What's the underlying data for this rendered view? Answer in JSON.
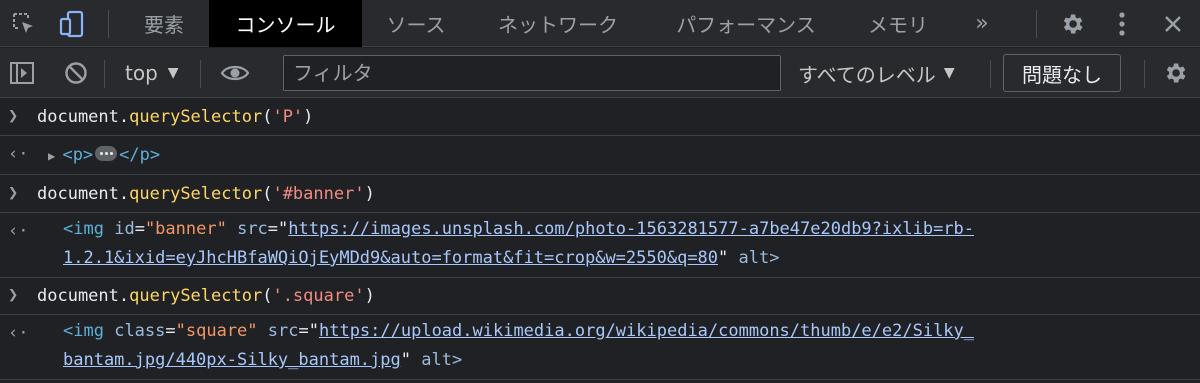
{
  "tabs": {
    "elements": "要素",
    "console": "コンソール",
    "sources": "ソース",
    "network": "ネットワーク",
    "performance": "パフォーマンス",
    "memory": "メモリ",
    "more": "»"
  },
  "toolbar": {
    "context": "top",
    "filter_placeholder": "フィルタ",
    "levels": "すべてのレベル",
    "issues_button": "問題なし"
  },
  "console": {
    "entries": [
      {
        "input_obj": "document",
        "input_method": "querySelector",
        "input_arg": "'P'",
        "output_open": "<p>",
        "output_close": "</p>"
      },
      {
        "input_obj": "document",
        "input_method": "querySelector",
        "input_arg": "'#banner'",
        "tag_open": "<img",
        "attr1": "id",
        "val1": "\"banner\"",
        "attr2": "src",
        "url_line1": "https://images.unsplash.com/photo-1563281577-a7be47e20db9?ixlib=rb-",
        "url_line2": "1.2.1&ixid=eyJhcHBfaWQiOjEyMDd9&auto=format&fit=crop&w=2550&q=80",
        "tail": "alt>"
      },
      {
        "input_obj": "document",
        "input_method": "querySelector",
        "input_arg": "'.square'",
        "tag_open": "<img",
        "attr1": "class",
        "val1": "\"square\"",
        "attr2": "src",
        "url_line1": "https://upload.wikimedia.org/wikipedia/commons/thumb/e/e2/Silky_",
        "url_line2": "bantam.jpg/440px-Silky_bantam.jpg",
        "tail": "alt>"
      }
    ]
  },
  "colors": {
    "background": "#202124",
    "toolbar": "#292a2d",
    "active_tab": "#000000",
    "method": "#fdd663",
    "string": "#f28b82",
    "tag": "#5db0d7",
    "attr_value": "#f29766",
    "link": "#a8c7fa"
  },
  "icons": [
    "inspect-element-icon",
    "device-toolbar-icon",
    "settings-gear-icon",
    "kebab-menu-icon",
    "close-icon",
    "sidebar-toggle-icon",
    "clear-console-icon",
    "eye-icon",
    "dropdown-triangle-icon"
  ]
}
